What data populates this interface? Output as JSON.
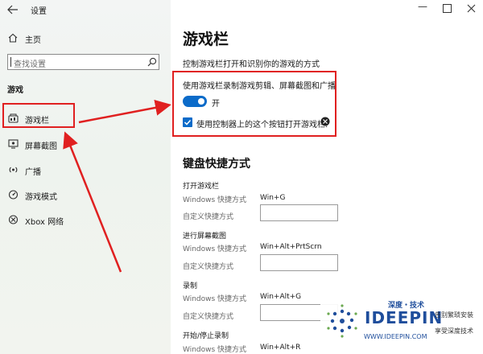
{
  "window": {
    "title": "设置"
  },
  "sidebar": {
    "home_label": "主页",
    "search_placeholder": "查找设置",
    "section_title": "游戏",
    "items": [
      {
        "label": "游戏栏",
        "icon": "game-bar-icon"
      },
      {
        "label": "屏幕截图",
        "icon": "captures-icon"
      },
      {
        "label": "广播",
        "icon": "broadcast-icon"
      },
      {
        "label": "游戏模式",
        "icon": "game-mode-icon"
      },
      {
        "label": "Xbox 网络",
        "icon": "xbox-icon"
      }
    ]
  },
  "main": {
    "title": "游戏栏",
    "description": "控制游戏栏打开和识别你的游戏的方式",
    "record_setting_label": "使用游戏栏录制游戏剪辑、屏幕截图和广播",
    "toggle_state": "开",
    "toggle_on": true,
    "controller_label": "使用控制器上的这个按钮打开游戏栏:",
    "controller_checked": true,
    "shortcuts_heading": "键盘快捷方式",
    "windows_shortcut_label": "Windows 快捷方式",
    "custom_shortcut_label": "自定义快捷方式",
    "shortcuts": [
      {
        "name": "打开游戏栏",
        "windows": "Win+G",
        "custom": ""
      },
      {
        "name": "进行屏幕截图",
        "windows": "Win+Alt+PrtScrn",
        "custom": ""
      },
      {
        "name": "录制",
        "windows": "Win+Alt+G",
        "custom": ""
      },
      {
        "name": "开始/停止录制",
        "windows": "Win+Alt+R",
        "custom": ""
      }
    ]
  },
  "watermark": {
    "brand_cn": "深度・技术",
    "brand_en": "IDEEPIN",
    "slogan1": "告别繁琐安装",
    "slogan2": "享受深度技术",
    "url": "WWW.IDEEPIN.COM"
  },
  "colors": {
    "accent": "#0b6bc9",
    "highlight": "#e02020",
    "watermark_blue": "#1f4e9c"
  }
}
